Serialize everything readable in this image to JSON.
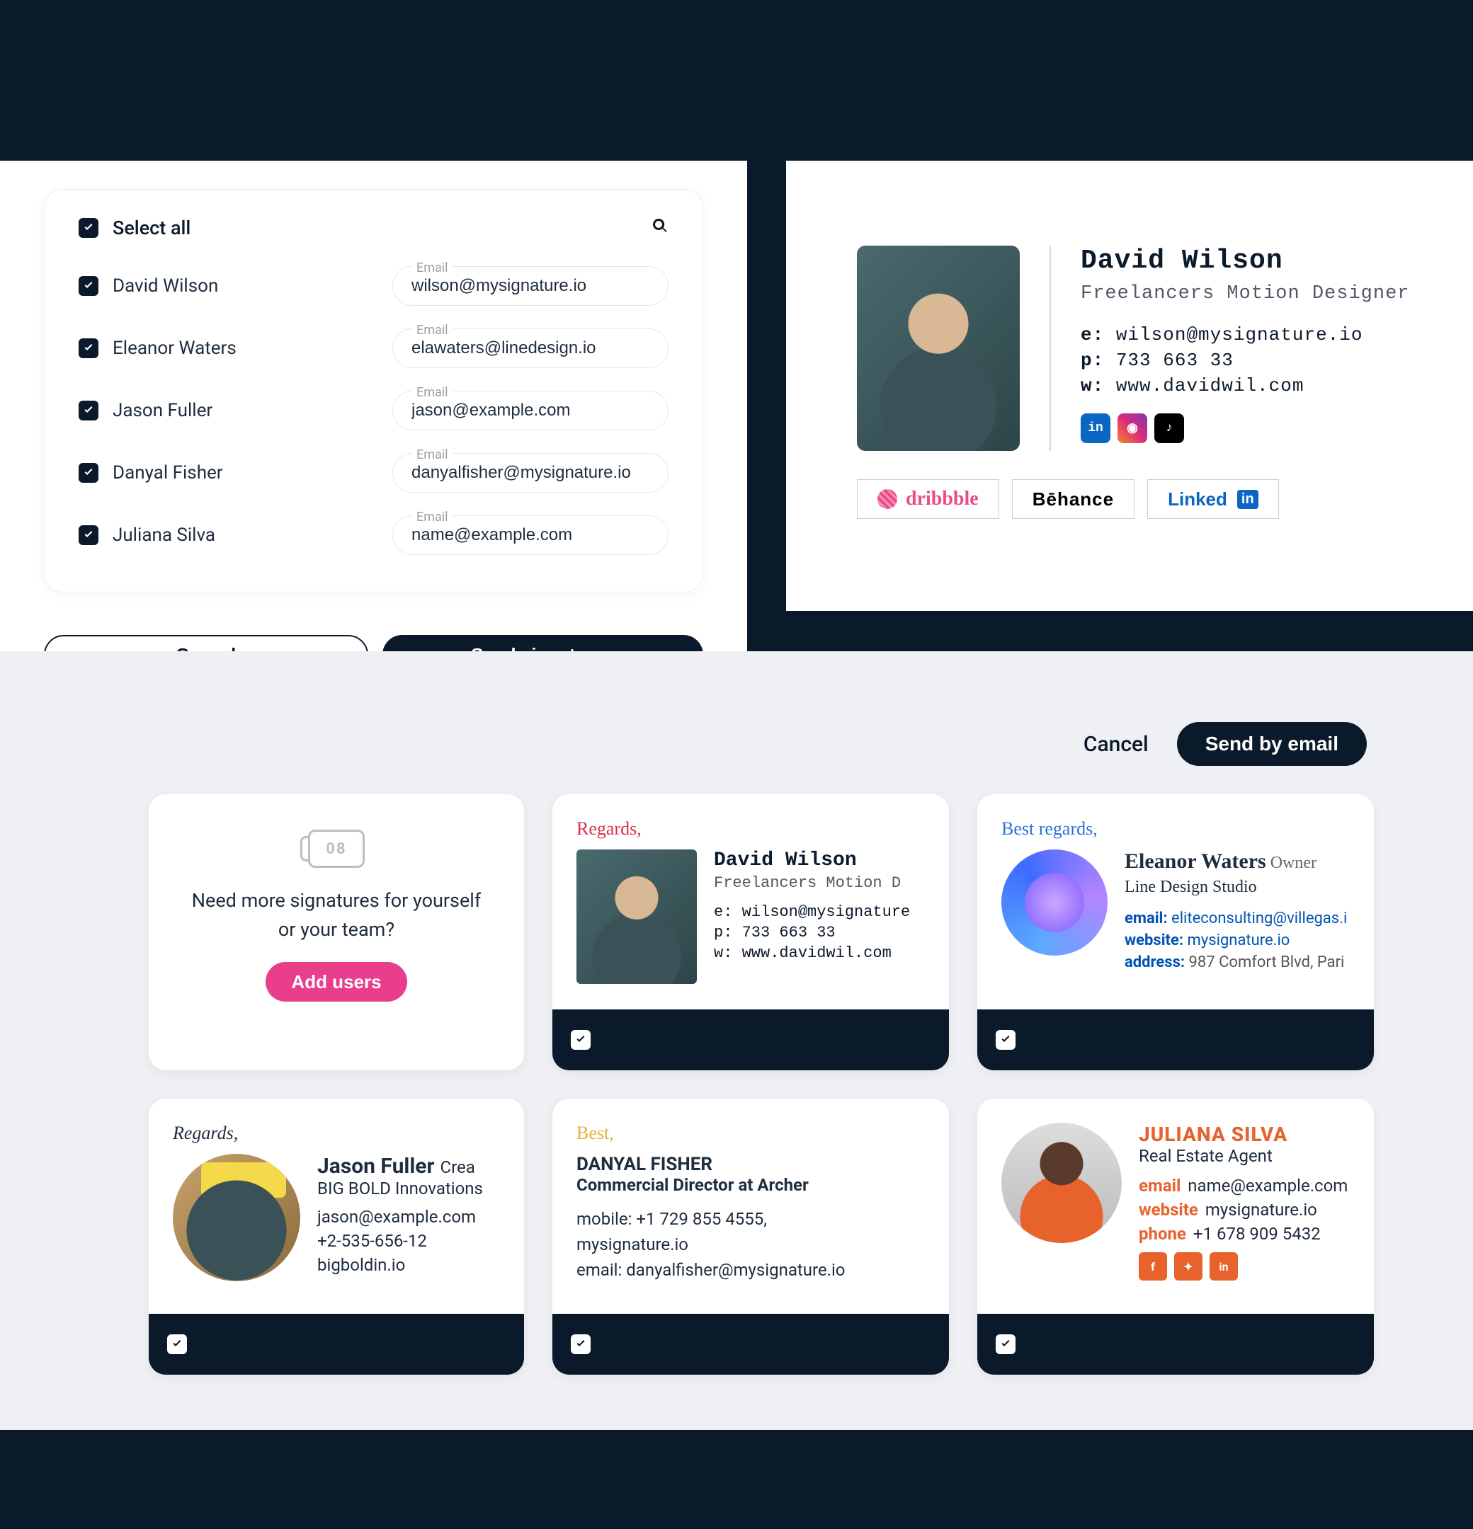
{
  "modal": {
    "select_all_label": "Select all",
    "users": [
      {
        "name": "David Wilson",
        "email": "wilson@mysignature.io"
      },
      {
        "name": "Eleanor Waters",
        "email": "elawaters@linedesign.io"
      },
      {
        "name": "Jason Fuller",
        "email": "jason@example.com"
      },
      {
        "name": "Danyal Fisher",
        "email": "danyalfisher@mysignature.io"
      },
      {
        "name": "Juliana Silva",
        "email": "name@example.com"
      }
    ],
    "email_float_label": "Email",
    "cancel_label": "Cancel",
    "send_label": "Send signatures"
  },
  "preview": {
    "name": "David Wilson",
    "title": "Freelancers Motion Designer",
    "email_label": "e:",
    "email": "wilson@mysignature.io",
    "phone_label": "p:",
    "phone": "733 663 33",
    "web_label": "w:",
    "web": "www.davidwil.com",
    "brands": {
      "dribbble": "dribbble",
      "behance": "Bēhance",
      "linkedin": "Linked",
      "linkedin_sq": "in"
    }
  },
  "gallery": {
    "cancel_label": "Cancel",
    "send_label": "Send by email",
    "addusers": {
      "text_line1": "Need more signatures for yourself",
      "text_line2": "or your team?",
      "button": "Add users"
    },
    "cards": {
      "david": {
        "salutation": "Regards,",
        "name": "David Wilson",
        "title": "Freelancers Motion D",
        "lines": [
          "e:  wilson@mysignature",
          "p:  733 663 33",
          "w:  www.davidwil.com"
        ]
      },
      "eleanor": {
        "salutation": "Best regards,",
        "name": "Eleanor Waters",
        "owner": "Owner",
        "studio": "Line Design Studio",
        "email_k": "email:",
        "email_v": "eliteconsulting@villegas.i",
        "website_k": "website:",
        "website_v": "mysignature.io",
        "address_k": "address:",
        "address_v": "987 Comfort Blvd, Pari"
      },
      "jason": {
        "salutation": "Regards,",
        "name": "Jason Fuller",
        "role": "Crea",
        "company": "BIG BOLD Innovations",
        "email": "jason@example.com",
        "phone": "+2-535-656-12",
        "site": "bigboldin.io"
      },
      "danyal": {
        "salutation": "Best,",
        "name": "DANYAL FISHER",
        "title": "Commercial Director at Archer",
        "mobile": "mobile: +1 729 855 4555,",
        "site": "mysignature.io",
        "email": "email: danyalfisher@mysignature.io"
      },
      "juliana": {
        "name": "JULIANA SILVA",
        "title": "Real Estate Agent",
        "email_k": "email",
        "email_v": "name@example.com",
        "website_k": "website",
        "website_v": "mysignature.io",
        "phone_k": "phone",
        "phone_v": "+1 678 909 5432"
      }
    }
  }
}
